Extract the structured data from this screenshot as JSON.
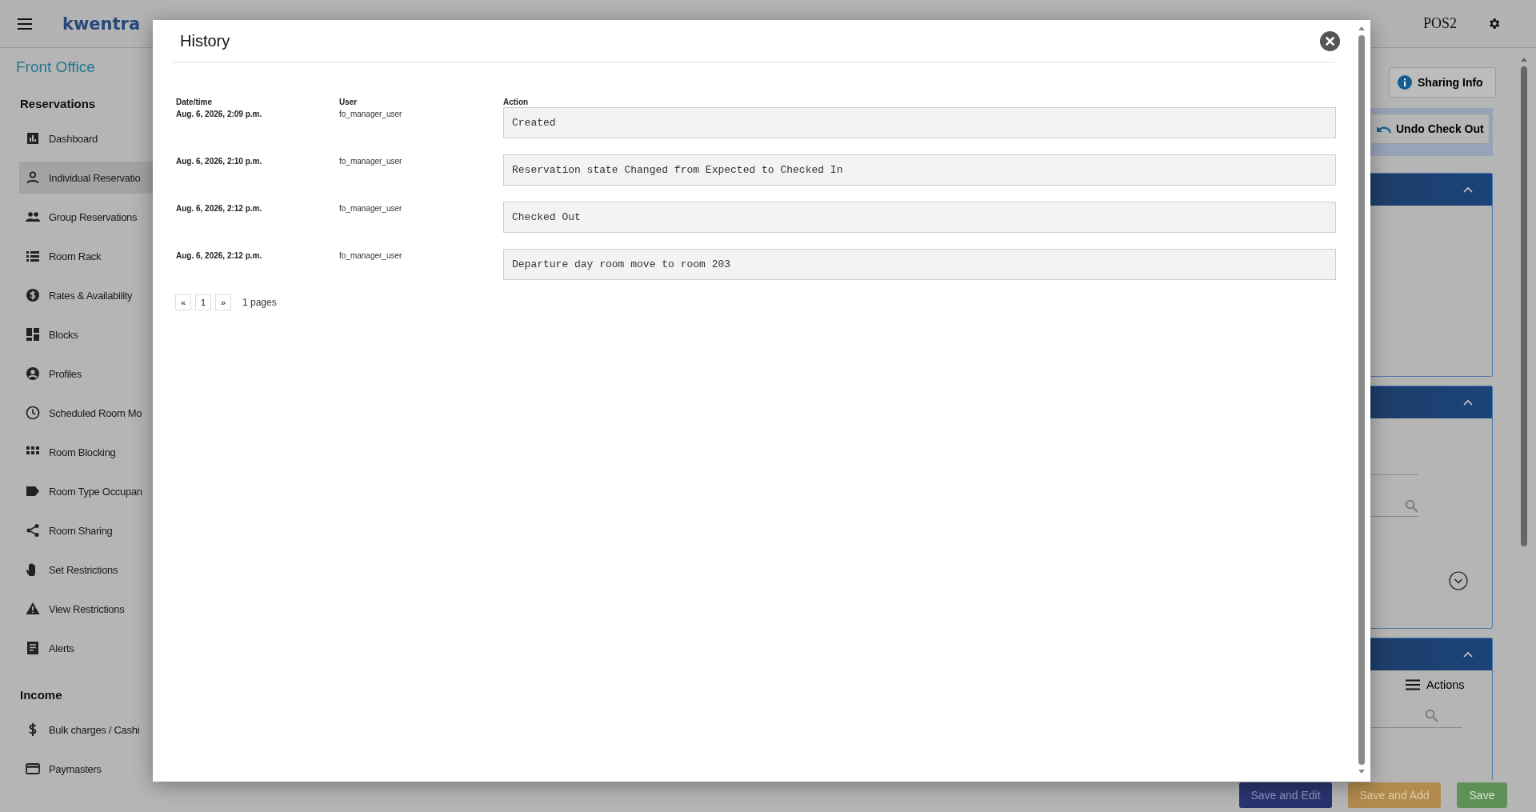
{
  "top_bar": {
    "logo": "kwentra",
    "terminal": "POS2"
  },
  "sidebar": {
    "title": "Front Office",
    "sections": [
      {
        "heading": "Reservations",
        "items": [
          {
            "label": "Dashboard",
            "selected": false
          },
          {
            "label": "Individual Reservatio",
            "selected": true
          },
          {
            "label": "Group Reservations",
            "selected": false
          },
          {
            "label": "Room Rack",
            "selected": false
          },
          {
            "label": "Rates & Availability",
            "selected": false
          },
          {
            "label": "Blocks",
            "selected": false
          },
          {
            "label": "Profiles",
            "selected": false
          },
          {
            "label": "Scheduled Room Mo",
            "selected": false
          },
          {
            "label": "Room Blocking",
            "selected": false
          },
          {
            "label": "Room Type Occupan",
            "selected": false
          },
          {
            "label": "Room Sharing",
            "selected": false
          },
          {
            "label": "Set Restrictions",
            "selected": false
          },
          {
            "label": "View Restrictions",
            "selected": false
          },
          {
            "label": "Alerts",
            "selected": false
          }
        ]
      },
      {
        "heading": "Income",
        "items": [
          {
            "label": "Bulk charges / Cashi",
            "selected": false
          },
          {
            "label": "Paymasters",
            "selected": false
          }
        ]
      }
    ]
  },
  "page": {
    "sharing_button": "Sharing Info",
    "undo_button": "Undo Check Out",
    "actions_label": "Actions",
    "footer_buttons": [
      {
        "label": "Save and Edit",
        "kind": "edit"
      },
      {
        "label": "Save and Add",
        "kind": "add"
      },
      {
        "label": "Save",
        "kind": "save"
      }
    ]
  },
  "history_modal": {
    "title": "History",
    "columns": [
      "Date/time",
      "User",
      "Action"
    ],
    "rows": [
      {
        "datetime": "Aug. 6, 2026, 2:09 p.m.",
        "user": "fo_manager_user",
        "action": "Created"
      },
      {
        "datetime": "Aug. 6, 2026, 2:10 p.m.",
        "user": "fo_manager_user",
        "action": "Reservation state Changed from Expected to Checked In"
      },
      {
        "datetime": "Aug. 6, 2026, 2:12 p.m.",
        "user": "fo_manager_user",
        "action": "Checked Out"
      },
      {
        "datetime": "Aug. 6, 2026, 2:12 p.m.",
        "user": "fo_manager_user",
        "action": "Departure day room move to room 203"
      }
    ],
    "pagination": {
      "previous": "«",
      "page": "1",
      "next": "»",
      "summary": "1 pages"
    }
  }
}
